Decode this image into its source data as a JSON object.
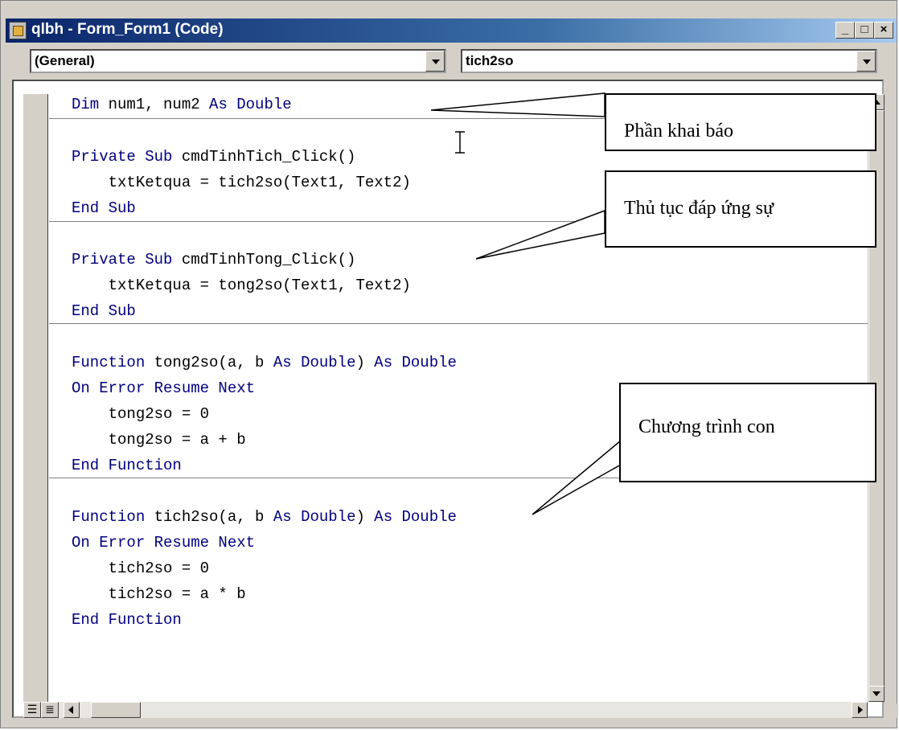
{
  "window": {
    "title": "qlbh - Form_Form1 (Code)",
    "buttons": {
      "minimize": "_",
      "maximize": "□",
      "close": "×"
    }
  },
  "object_combo": {
    "value": "(General)"
  },
  "procedure_combo": {
    "value": "tich2so"
  },
  "code": [
    [
      {
        "t": "Dim",
        "k": true
      },
      {
        "t": " num1, num2 "
      },
      {
        "t": "As Double",
        "k": true
      }
    ],
    [
      {
        "t": "Private Sub",
        "k": true
      },
      {
        "t": " cmdTinhTich_Click()"
      }
    ],
    [
      {
        "t": "    txtKetqua = tich2so(Text1, Text2)"
      }
    ],
    [
      {
        "t": "End Sub",
        "k": true
      }
    ],
    [
      {
        "t": "Private Sub",
        "k": true
      },
      {
        "t": " cmdTinhTong_Click()"
      }
    ],
    [
      {
        "t": "    txtKetqua = tong2so(Text1, Text2)"
      }
    ],
    [
      {
        "t": "End Sub",
        "k": true
      }
    ],
    [
      {
        "t": "Function",
        "k": true
      },
      {
        "t": " tong2so(a, b "
      },
      {
        "t": "As Double",
        "k": true
      },
      {
        "t": ") "
      },
      {
        "t": "As Double",
        "k": true
      }
    ],
    [
      {
        "t": "On Error Resume Next",
        "k": true
      }
    ],
    [
      {
        "t": "    tong2so = 0"
      }
    ],
    [
      {
        "t": "    tong2so = a + b"
      }
    ],
    [
      {
        "t": "End Function",
        "k": true
      }
    ],
    [
      {
        "t": "Function",
        "k": true
      },
      {
        "t": " tich2so(a, b "
      },
      {
        "t": "As Double",
        "k": true
      },
      {
        "t": ") "
      },
      {
        "t": "As Double",
        "k": true
      }
    ],
    [
      {
        "t": "On Error Resume Next",
        "k": true
      }
    ],
    [
      {
        "t": "    tich2so = 0"
      }
    ],
    [
      {
        "t": "    tich2so = a * b"
      }
    ],
    [
      {
        "t": "End Function",
        "k": true
      }
    ]
  ],
  "callouts": {
    "declaration": "Phần khai báo",
    "event_procedure": "Thủ tục đáp ứng sự",
    "subprogram": "Chương trình con"
  },
  "colors": {
    "keyword": "#00007f",
    "code_text": "#000000",
    "title_bar": "#0a246a"
  },
  "icons": {
    "app": "vb-form-icon",
    "procedure_view": "procedure-view-icon",
    "full_module_view": "full-module-view-icon"
  }
}
